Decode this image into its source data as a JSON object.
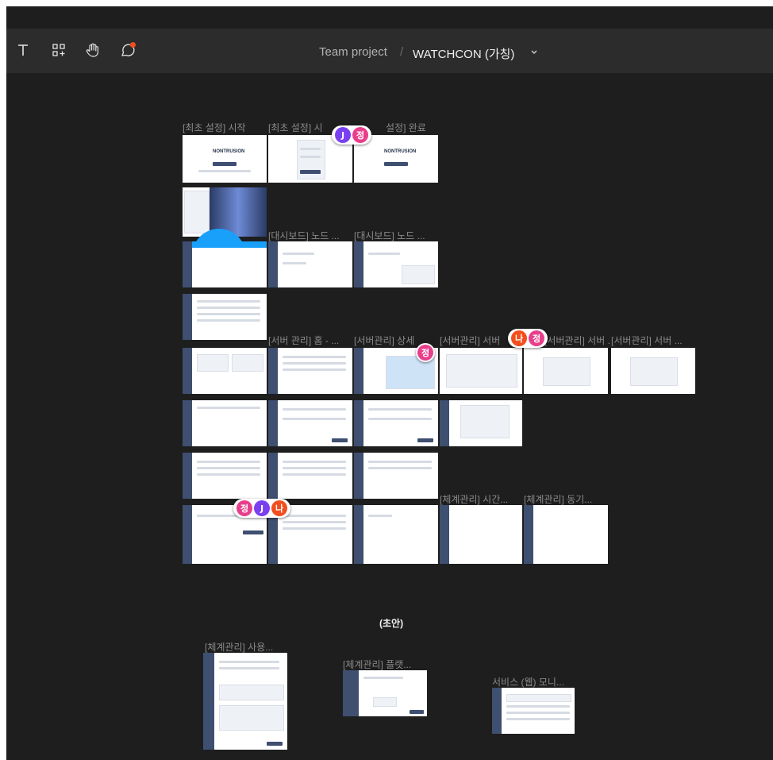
{
  "toolbar": {
    "tools": [
      {
        "name": "text-tool",
        "icon": "text-icon"
      },
      {
        "name": "component-tool",
        "icon": "components-icon"
      },
      {
        "name": "hand-tool",
        "icon": "hand-icon"
      },
      {
        "name": "comment-tool",
        "icon": "comment-icon",
        "has_notification": true
      }
    ]
  },
  "breadcrumb": {
    "team": "Team project",
    "separator": "/",
    "file": "WATCHCON (가칭)"
  },
  "canvas": {
    "draft_heading": "(초안)",
    "frame_labels": {
      "f1": "[최초 설정] 시작",
      "f2": "[최초 설정] 시",
      "f3": "설정] 완료",
      "f5": "[대시보드] 노드 ...",
      "f6": "[대시보드] 노드 ...",
      "f8": "[서버 관리] 홈 - ...",
      "f9": "[서버관리] 상세",
      "f10": "[서버관리] 서버",
      "f11": "[서버관리] 서버 ...",
      "f12": "[서버관리] 서버 ...",
      "f13": "[체계관리] 시간...",
      "f14": "[체계관리] 동기...",
      "d1": "[체계관리] 사용...",
      "d2": "[체계관리] 플랫...",
      "d3": "서비스 (웹) 모니..."
    },
    "frame_texts": {
      "brand": "NONTRUSION"
    }
  },
  "avatars": {
    "j": {
      "letter": "J",
      "color": "#7b3ff2"
    },
    "na": {
      "letter": "나",
      "color": "#f24e1e"
    },
    "jeong": {
      "letter": "정",
      "color": "#e83e8c"
    }
  }
}
